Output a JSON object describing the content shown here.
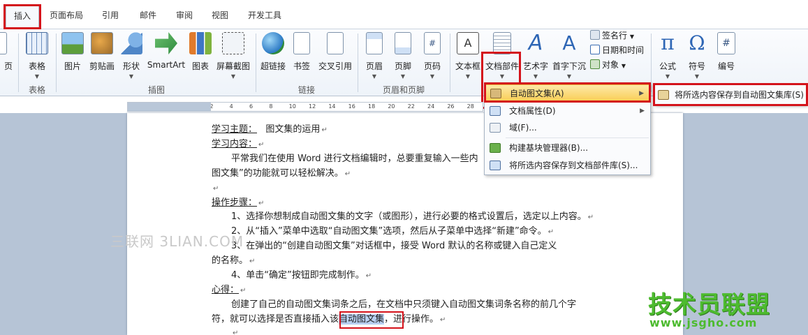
{
  "tabs": [
    {
      "id": "insert",
      "label": "插入",
      "active": true
    },
    {
      "id": "layout",
      "label": "页面布局"
    },
    {
      "id": "references",
      "label": "引用"
    },
    {
      "id": "mailings",
      "label": "邮件"
    },
    {
      "id": "review",
      "label": "审阅"
    },
    {
      "id": "view",
      "label": "视图"
    },
    {
      "id": "developer",
      "label": "开发工具"
    }
  ],
  "ribbon": {
    "page_partial": "页",
    "table": "表格",
    "picture": "图片",
    "clipart": "剪贴画",
    "shapes": "形状",
    "smartart": "SmartArt",
    "chart": "图表",
    "screenshot": "屏幕截图",
    "hyperlink": "超链接",
    "bookmark": "书签",
    "crossref": "交叉引用",
    "header": "页眉",
    "footer": "页脚",
    "pagenum": "页码",
    "textbox": "文本框",
    "quickparts": "文档部件",
    "wordart": "艺术字",
    "dropcap": "首字下沉",
    "signature": "签名行",
    "datetime": "日期和时间",
    "object": "对象",
    "equation": "公式",
    "symbol": "符号",
    "number": "编号",
    "groups": {
      "table": "表格",
      "illustrations": "插图",
      "links": "链接",
      "headerfooter": "页眉和页脚"
    }
  },
  "ruler": [
    "8",
    "6",
    "4",
    "2",
    "2",
    "4",
    "6",
    "8",
    "10",
    "12",
    "14",
    "16",
    "18",
    "20",
    "22",
    "24",
    "26",
    "28"
  ],
  "menu": {
    "autotext": "自动图文集(A)",
    "docprop": "文档属性(D)",
    "field": "域(F)...",
    "organizer": "构建基块管理器(B)...",
    "savegallery": "将所选内容保存到文档部件库(S)..."
  },
  "submenu": {
    "save_autotext": "将所选内容保存到自动图文集库(S)"
  },
  "document": {
    "topic_label": "学习主题：",
    "topic_value": "图文集的运用",
    "content_label": "学习内容：",
    "p1_a": "平常我们在使用 Word 进行文档编辑时，总要重复输入一些内",
    "p1_b": "图文集”的功能就可以轻松解决。",
    "steps_label": "操作步骤：",
    "s1": "1、选择你想制成自动图文集的文字（或图形），进行必要的格式设置后，选定以上内容。",
    "s2": "2、从“插入”菜单中选取“自动图文集”选项，然后从子菜单中选择“新建”命令。",
    "s3": "3、在弹出的“创建自动图文集”对话框中，接受 Word 默认的名称或键入自己定义",
    "s3b": "的名称。",
    "s4": "4、单击“确定”按钮即完成制作。",
    "notes_label": "心得：",
    "n1": "创建了自己的自动图文集词条之后，在文档中只须键入自动图文集词条名称的前几个字",
    "n2_a": "符，就可以选择是否直接插入该",
    "n2_hl": "自动图文集",
    "n2_b": "，进行操作。"
  },
  "watermark": "三联网 3LIAN.COM",
  "logo": {
    "title": "技术员联盟",
    "url": "www.jsgho.com"
  },
  "colors": {
    "highlight_red": "#d4131b",
    "menu_hot": "#f9cf58",
    "logo_green": "#4dbb2f"
  }
}
